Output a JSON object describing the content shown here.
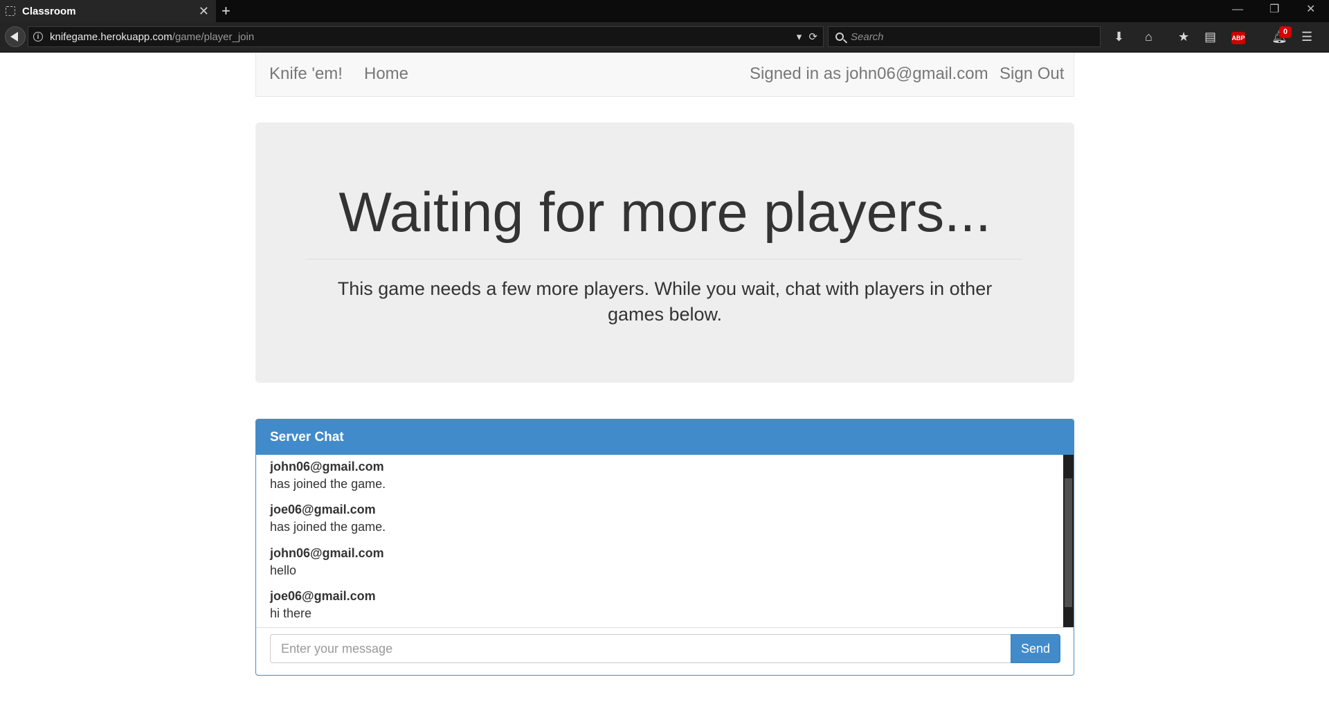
{
  "browser": {
    "tab_title": "Classroom",
    "tab_close": "✕",
    "new_tab": "+",
    "url_host": "knifegame.herokuapp.com",
    "url_path": "/game/player_join",
    "search_placeholder": "Search",
    "notification_count": "0",
    "abp_label": "ABP",
    "window_minimize": "—",
    "window_restore": "❐",
    "window_close": "✕"
  },
  "nav": {
    "brand": "Knife 'em!",
    "home": "Home",
    "signed_in": "Signed in as john06@gmail.com",
    "sign_out": "Sign Out"
  },
  "jumbotron": {
    "headline": "Waiting for more players...",
    "lead": "This game needs a few more players. While you wait, chat with players in other games below."
  },
  "chat": {
    "heading": "Server Chat",
    "messages": [
      {
        "author": "john06@gmail.com",
        "text": "has joined the game."
      },
      {
        "author": "joe06@gmail.com",
        "text": "has joined the game."
      },
      {
        "author": "john06@gmail.com",
        "text": "hello"
      },
      {
        "author": "joe06@gmail.com",
        "text": "hi there"
      }
    ],
    "input_placeholder": "Enter your message",
    "input_value": "",
    "send_label": "Send"
  },
  "icons": [
    "back-icon",
    "info-icon",
    "dropdown-icon",
    "reload-icon",
    "search-icon",
    "download-icon",
    "home-icon",
    "bookmark-star-icon",
    "reading-list-icon",
    "adblock-icon",
    "notification-icon",
    "menu-icon"
  ]
}
